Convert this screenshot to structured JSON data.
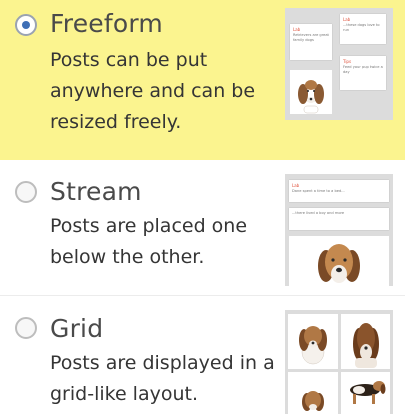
{
  "options": [
    {
      "id": "freeform",
      "title": "Freeform",
      "description": "Posts can be put anywhere and can be resized freely.",
      "selected": true,
      "thumbnail_notes": [
        {
          "heading": "Lab",
          "text": "Retrievers are great family dogs"
        },
        {
          "heading": "Lab",
          "text": "...these dogs love to run"
        },
        {
          "heading": "Tips",
          "text": "Feed your pup twice a day"
        }
      ]
    },
    {
      "id": "stream",
      "title": "Stream",
      "description": "Posts are placed one below the other.",
      "selected": false,
      "thumbnail_notes": [
        {
          "heading": "Lab",
          "text": "Dane spent a time to a bed..."
        },
        {
          "heading": "",
          "text": "...there lived a boy and more"
        }
      ]
    },
    {
      "id": "grid",
      "title": "Grid",
      "description": "Posts are displayed in a grid-like layout.",
      "selected": false
    }
  ],
  "colors": {
    "selected_bg": "#fbf48f",
    "radio_dot": "#3f6fb6",
    "note_heading": "#e0503a"
  }
}
